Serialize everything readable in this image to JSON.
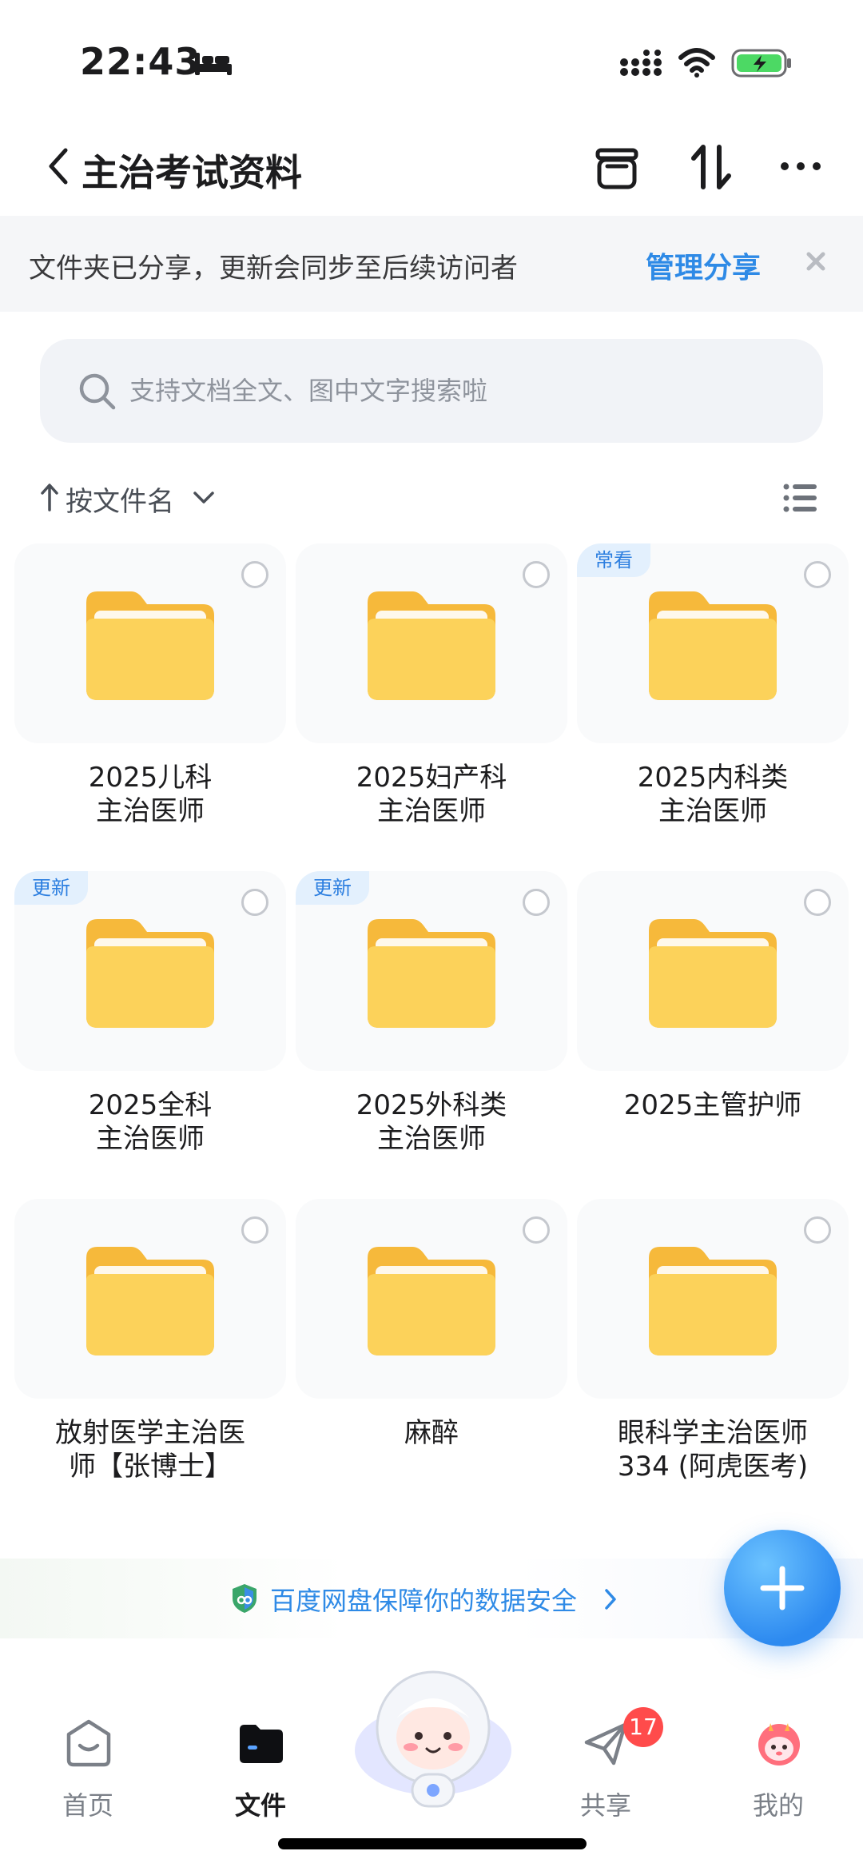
{
  "status_bar": {
    "time": "22:43"
  },
  "header": {
    "title": "主治考试资料"
  },
  "notice": {
    "text": "文件夹已分享，更新会同步至后续访问者",
    "action": "管理分享"
  },
  "search": {
    "placeholder": "支持文档全文、图中文字搜索啦"
  },
  "sort": {
    "label": "按文件名"
  },
  "folders": [
    {
      "line1": "2025儿科",
      "line2": "主治医师",
      "tag": ""
    },
    {
      "line1": "2025妇产科",
      "line2": "主治医师",
      "tag": ""
    },
    {
      "line1": "2025内科类",
      "line2": "主治医师",
      "tag": "常看"
    },
    {
      "line1": "2025全科",
      "line2": "主治医师",
      "tag": "更新"
    },
    {
      "line1": "2025外科类",
      "line2": "主治医师",
      "tag": "更新"
    },
    {
      "line1": "2025主管护师",
      "line2": "",
      "tag": ""
    },
    {
      "line1": "放射医学主治医",
      "line2": "师【张博士】",
      "tag": ""
    },
    {
      "line1": "麻醉",
      "line2": "",
      "tag": ""
    },
    {
      "line1": "眼科学主治医师",
      "line2": "334 (阿虎医考)",
      "tag": ""
    }
  ],
  "security": {
    "text": "百度网盘保障你的数据安全"
  },
  "bottom_nav": {
    "items": [
      {
        "label": "首页",
        "active": false
      },
      {
        "label": "文件",
        "active": true
      },
      {
        "label": "共享",
        "active": false,
        "badge": "17"
      },
      {
        "label": "我的",
        "active": false
      }
    ]
  },
  "colors": {
    "accent": "#2e8ae6",
    "folder_yellow": "#fcd25a",
    "badge_red": "#ff4b4b"
  },
  "icons": [
    "bed-icon",
    "signal-icon",
    "wifi-icon",
    "battery-icon",
    "back-icon",
    "archive-icon",
    "sort-icon",
    "more-icon",
    "close-icon",
    "search-icon",
    "sort-arrow-icon",
    "chevron-down-icon",
    "list-view-icon",
    "folder-icon",
    "shield-icon",
    "plus-icon",
    "home-icon",
    "files-icon",
    "share-icon",
    "profile-icon"
  ]
}
